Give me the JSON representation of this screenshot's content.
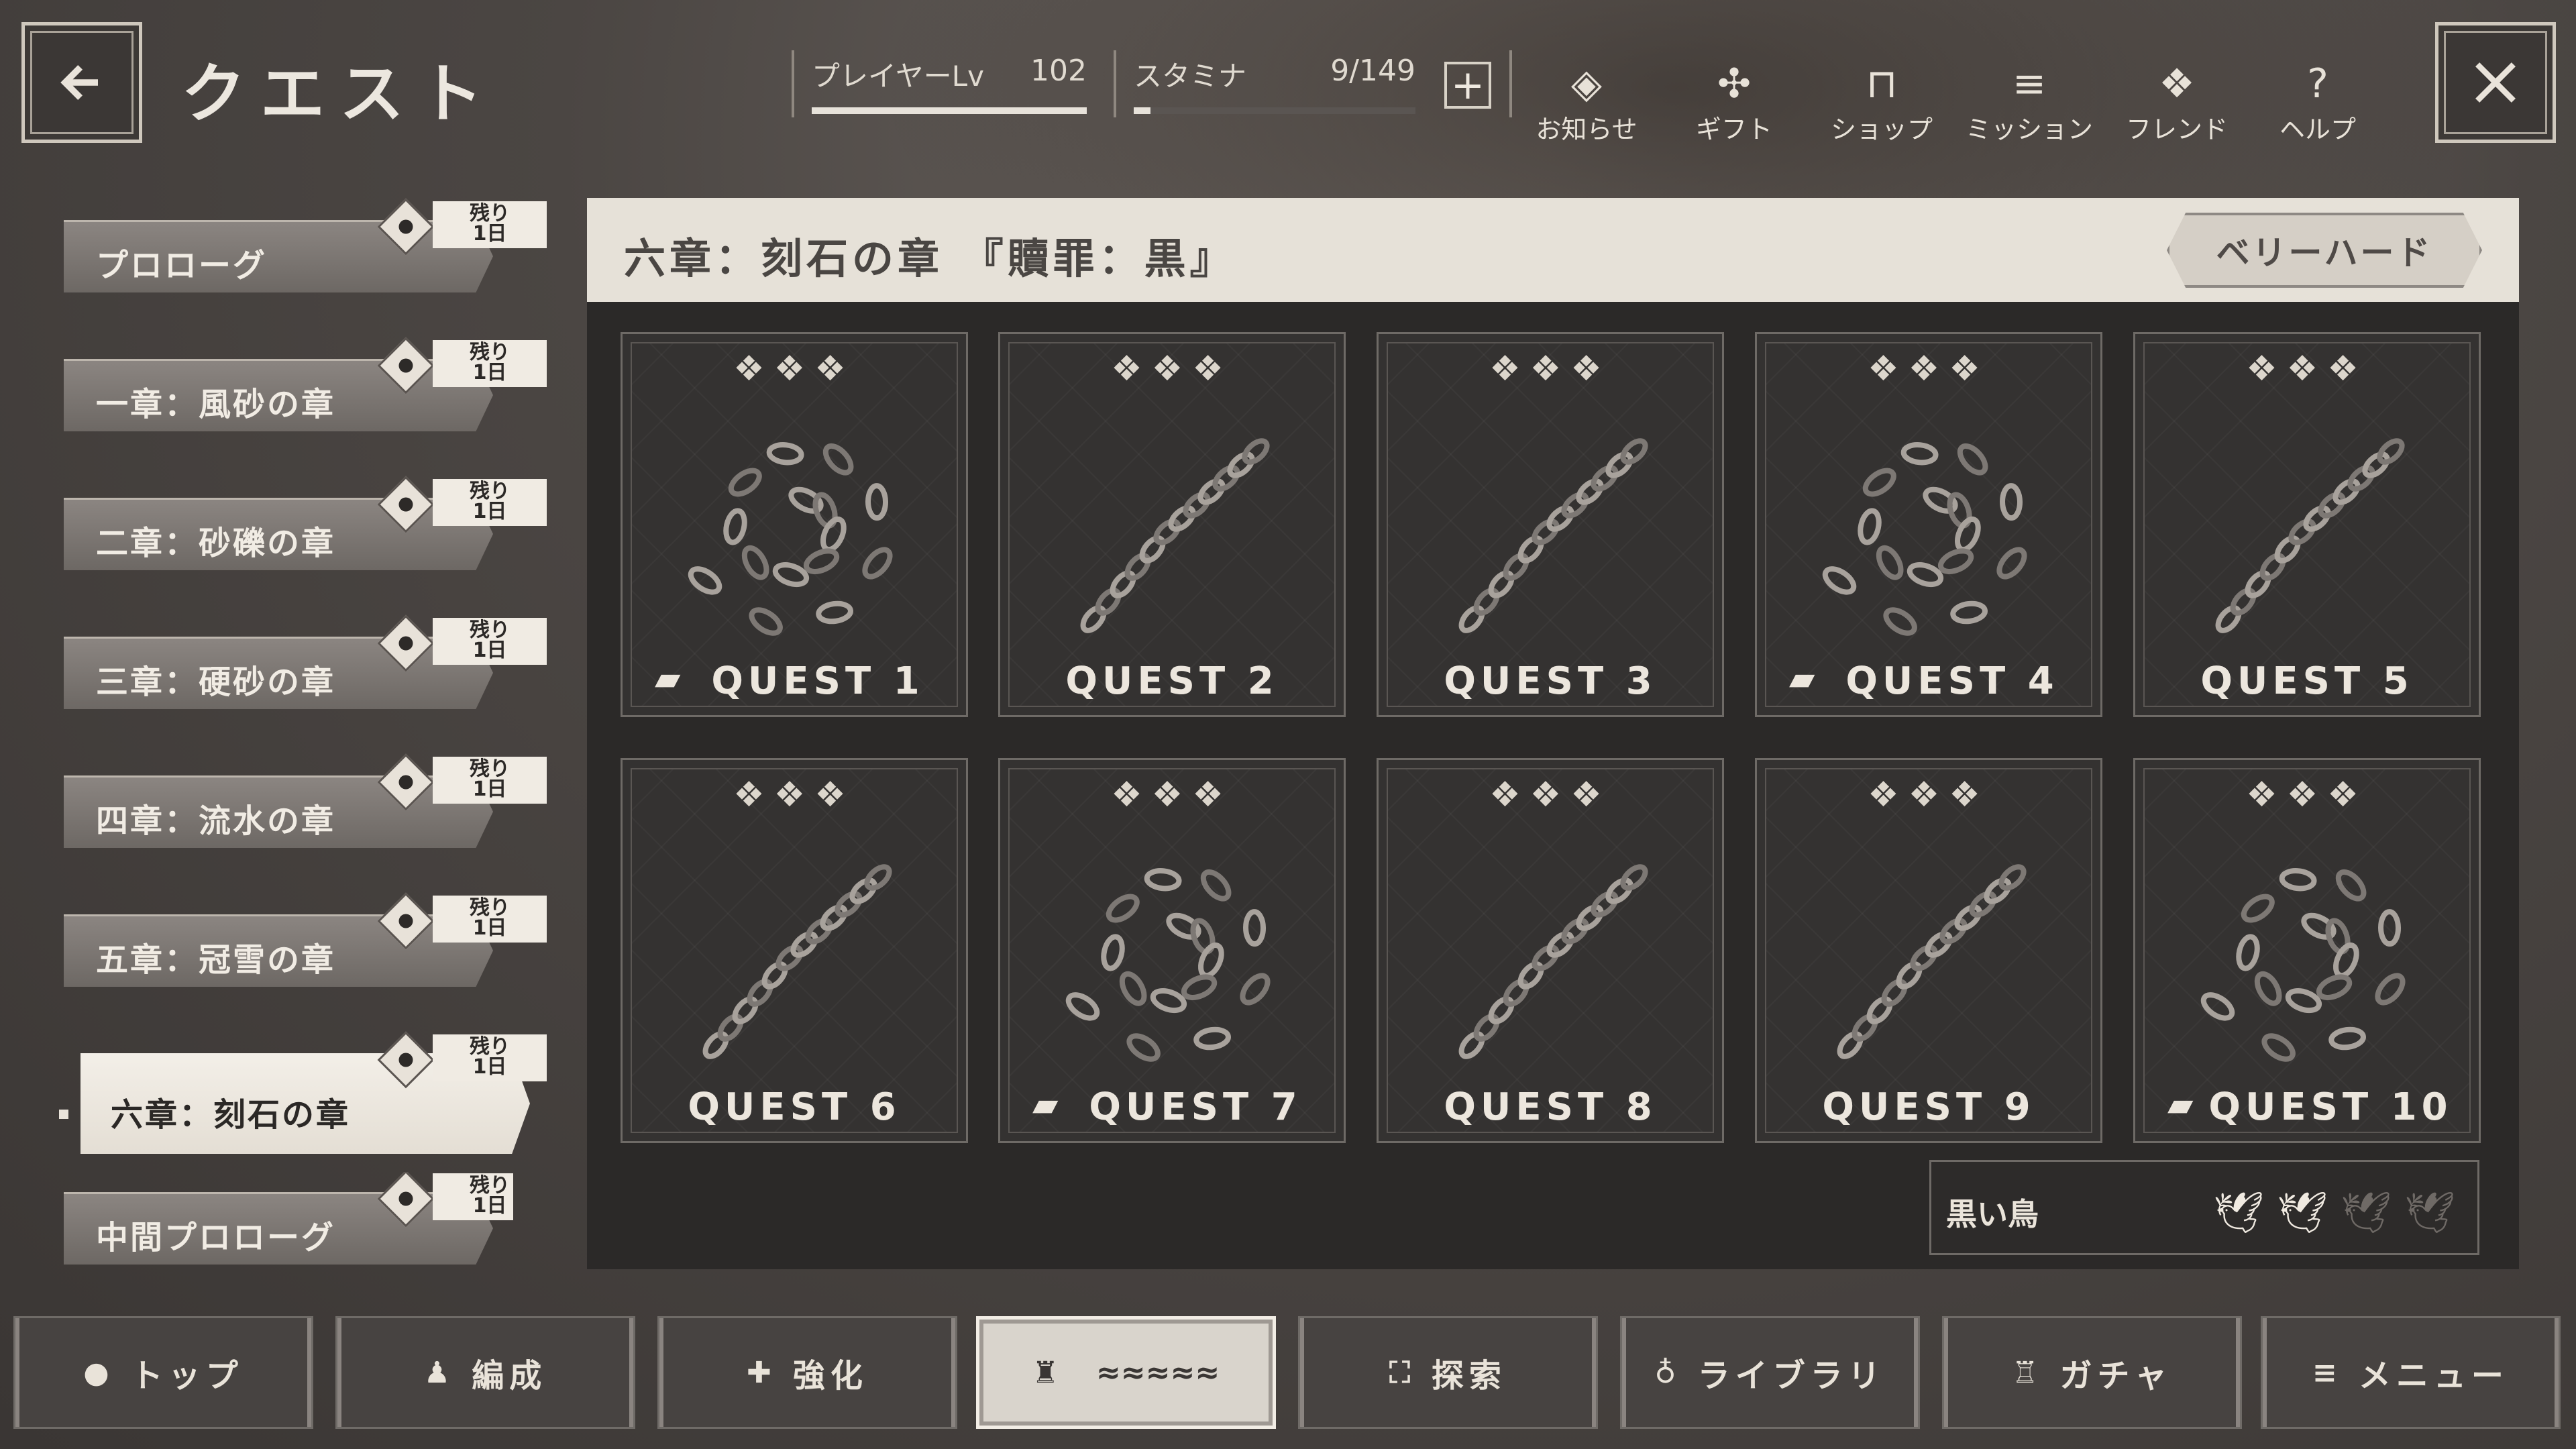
{
  "header": {
    "title": "クエスト",
    "player_level_label": "プレイヤーLv",
    "player_level_value": "102",
    "stamina_label": "スタミナ",
    "stamina_value": "9/149",
    "player_level_progress": 1.0,
    "stamina_progress": 0.06,
    "menu": [
      {
        "label": "お知らせ",
        "icon": "notice-icon"
      },
      {
        "label": "ギフト",
        "icon": "gift-icon"
      },
      {
        "label": "ショップ",
        "icon": "shop-icon"
      },
      {
        "label": "ミッション",
        "icon": "mission-icon"
      },
      {
        "label": "フレンド",
        "icon": "friend-icon"
      },
      {
        "label": "ヘルプ",
        "icon": "help-icon"
      }
    ]
  },
  "chapters": [
    {
      "name": "プロローグ",
      "badge": "残り\n1日"
    },
    {
      "name": "一章：風砂の章",
      "badge": "残り\n1日"
    },
    {
      "name": "二章：砂礫の章",
      "badge": "残り\n1日"
    },
    {
      "name": "三章：硬砂の章",
      "badge": "残り\n1日"
    },
    {
      "name": "四章：流水の章",
      "badge": "残り\n1日"
    },
    {
      "name": "五章：冠雪の章",
      "badge": "残り\n1日"
    },
    {
      "name": "六章：刻石の章",
      "badge": "残り\n1日",
      "active": true
    },
    {
      "name": "中間プロローグ",
      "badge": "残り\n1日"
    }
  ],
  "panel": {
    "chapter_title": "六章：刻石の章 『贖罪：黒』",
    "difficulty": "ベリーハード",
    "quests": [
      {
        "label": "QUEST 1",
        "book": true,
        "chain": "coil"
      },
      {
        "label": "QUEST 2",
        "book": false,
        "chain": "strand"
      },
      {
        "label": "QUEST 3",
        "book": false,
        "chain": "strand"
      },
      {
        "label": "QUEST 4",
        "book": true,
        "chain": "coil"
      },
      {
        "label": "QUEST 5",
        "book": false,
        "chain": "strand"
      },
      {
        "label": "QUEST 6",
        "book": false,
        "chain": "strand"
      },
      {
        "label": "QUEST 7",
        "book": true,
        "chain": "coil"
      },
      {
        "label": "QUEST 8",
        "book": false,
        "chain": "strand"
      },
      {
        "label": "QUEST 9",
        "book": false,
        "chain": "strand"
      },
      {
        "label": "QUEST 10",
        "book": true,
        "chain": "coil"
      }
    ],
    "enemy": {
      "name": "黒い鳥",
      "filled": 2,
      "total": 4
    }
  },
  "nav": [
    {
      "label": "トップ",
      "icon": "home-icon"
    },
    {
      "label": "編成",
      "icon": "party-icon"
    },
    {
      "label": "強化",
      "icon": "enhance-icon"
    },
    {
      "label": "",
      "icon": "quest-icon",
      "active": true
    },
    {
      "label": "探索",
      "icon": "explore-icon"
    },
    {
      "label": "ライブラリ",
      "icon": "library-icon"
    },
    {
      "label": "ガチャ",
      "icon": "gacha-icon"
    },
    {
      "label": "メニュー",
      "icon": "menu-icon"
    }
  ],
  "colors": {
    "panel_bg": "#2b2928",
    "header_bg": "#e6e1d8",
    "accent_light": "#f3efe8"
  }
}
